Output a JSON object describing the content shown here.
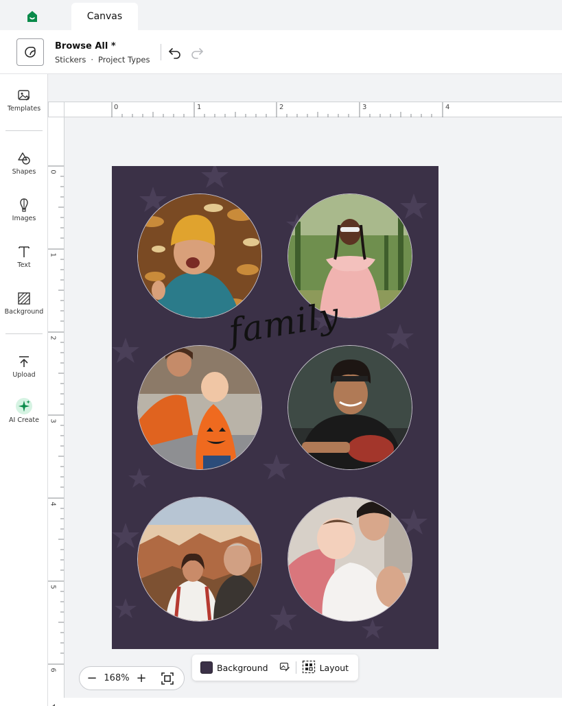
{
  "tabs": {
    "home_icon": "home-icon",
    "active_tab": "Canvas"
  },
  "header": {
    "title": "Browse All *",
    "breadcrumb": [
      "Stickers",
      "Project Types"
    ],
    "undo_icon": "undo-icon",
    "redo_icon": "redo-icon"
  },
  "sidebar": {
    "items": [
      {
        "label": "Templates",
        "icon": "templates-icon"
      },
      {
        "label": "Shapes",
        "icon": "shapes-icon"
      },
      {
        "label": "Images",
        "icon": "images-icon"
      },
      {
        "label": "Text",
        "icon": "text-icon"
      },
      {
        "label": "Background",
        "icon": "background-icon"
      },
      {
        "label": "Upload",
        "icon": "upload-icon"
      },
      {
        "label": "AI Create",
        "icon": "sparkle-icon"
      }
    ]
  },
  "rulers": {
    "horizontal": [
      "0",
      "1",
      "2",
      "3",
      "4"
    ],
    "vertical": [
      "0",
      "1",
      "2",
      "3",
      "4",
      "5",
      "6"
    ]
  },
  "canvas": {
    "background_color": "#3b3147",
    "text": "family",
    "photos": [
      "child-in-yellow-hat-on-leaves",
      "girl-in-pink-dress",
      "mother-and-baby-in-pumpkin-shirts",
      "young-man-with-baseball-glove",
      "couple-selfie-in-canyon",
      "father-holding-baby"
    ]
  },
  "zoom": {
    "minus": "−",
    "value": "168%",
    "plus": "+",
    "fit_icon": "fit-screen-icon"
  },
  "bg_toolbar": {
    "background_label": "Background",
    "layout_label": "Layout",
    "edit_icon": "edit-image-icon",
    "layout_icon": "layout-icon",
    "swatch_color": "#3b3147"
  },
  "colors": {
    "accent": "#0a8a4a",
    "canvas_bg": "#3b3147",
    "page_bg": "#f2f3f5"
  }
}
